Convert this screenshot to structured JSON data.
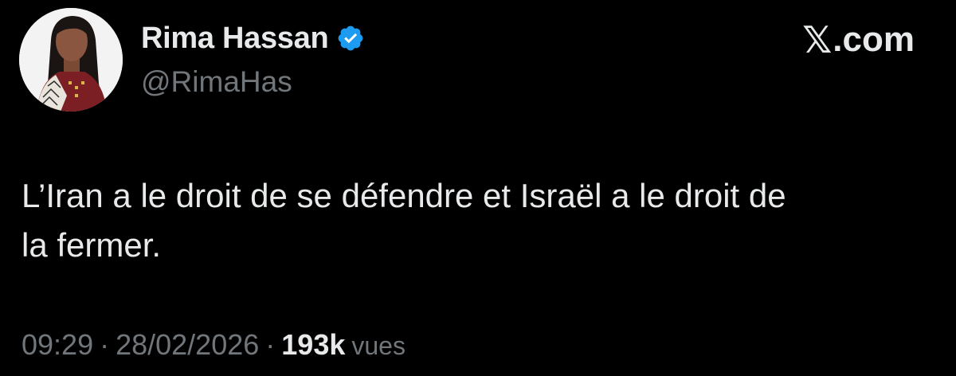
{
  "author": {
    "display_name": "Rima Hassan",
    "handle": "@RimaHas",
    "verified": true,
    "verified_color": "#1d9bf0"
  },
  "brand": {
    "label": ".com",
    "icon": "x-logo-icon"
  },
  "tweet": {
    "text": "L’Iran a le droit de se défendre et Israël a le droit de\nla fermer."
  },
  "meta": {
    "time": "09:29",
    "separator": "·",
    "date": "28/02/2026",
    "views_count": "193k",
    "views_label": "vues"
  },
  "colors": {
    "background": "#000000",
    "primary_text": "#e7e9ea",
    "secondary_text": "#71767b"
  }
}
